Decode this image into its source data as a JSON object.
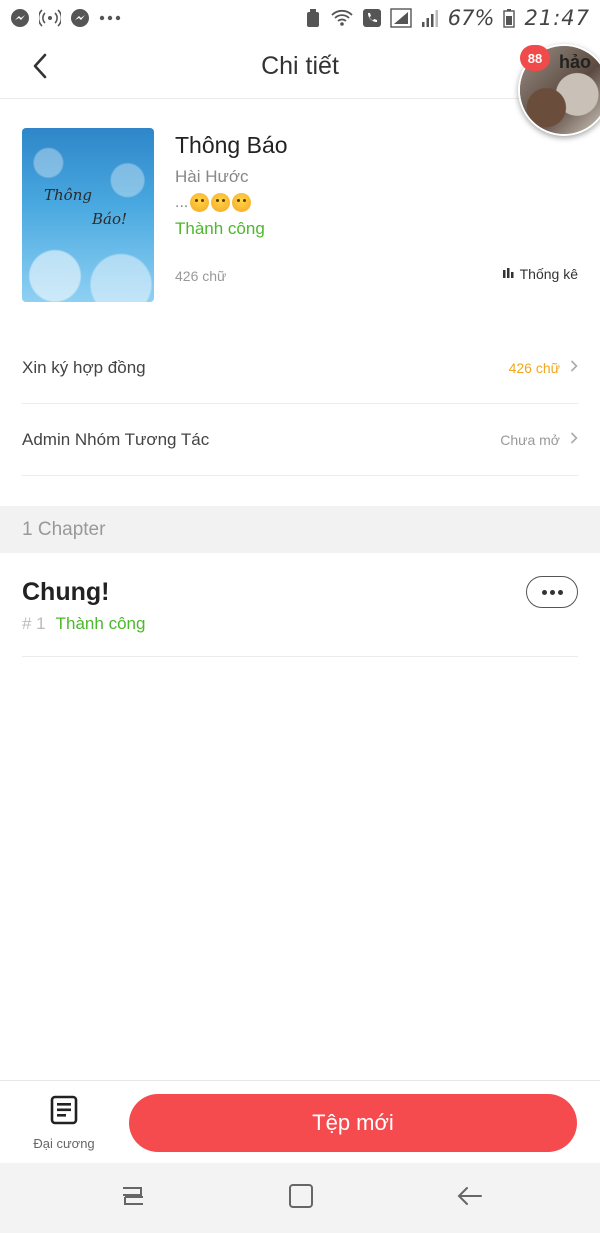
{
  "status_bar": {
    "time": "21:47",
    "battery": "67%",
    "icons": [
      "messenger-icon",
      "hotspot-icon",
      "messenger-icon",
      "more-dots-icon",
      "recycle-icon",
      "wifi-icon",
      "call-icon",
      "signal-icon",
      "signal-icon",
      "battery-icon"
    ]
  },
  "header": {
    "title": "Chi tiết",
    "back_icon": "chevron-left-icon"
  },
  "chat_bubble": {
    "badge_count": "88",
    "name": "hảo"
  },
  "book": {
    "cover_text_line1": "Thông",
    "cover_text_line2": "Báo!",
    "title": "Thông Báo",
    "genre": "Hài Hước",
    "description_prefix": "...",
    "status": "Thành công",
    "word_count": "426 chữ",
    "stats_label": "Thống kê"
  },
  "rows": [
    {
      "label": "Xin ký hợp đồng",
      "value": "426 chữ"
    },
    {
      "label": "Admin Nhóm Tương Tác",
      "value": "Chưa mở"
    }
  ],
  "chapters_section": {
    "title": "1 Chapter"
  },
  "chapters": [
    {
      "title": "Chung!",
      "number": "# 1",
      "status": "Thành công"
    }
  ],
  "bottom_bar": {
    "outline_label": "Đại cương",
    "new_file_label": "Tệp mới"
  },
  "colors": {
    "accent": "#f54a4e",
    "success": "#4cb82c",
    "warning": "#f0a81c"
  }
}
